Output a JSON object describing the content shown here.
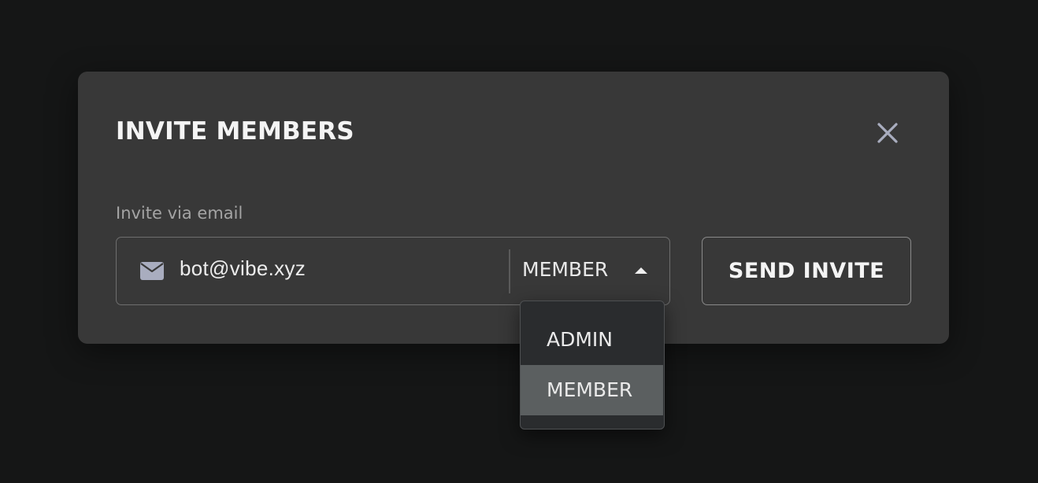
{
  "modal": {
    "title": "INVITE MEMBERS",
    "close_icon": "close-icon"
  },
  "invite": {
    "label": "Invite via email",
    "email_icon": "mail-icon",
    "email_value": "bot@vibe.xyz",
    "role_selected": "MEMBER",
    "role_caret_icon": "caret-up-icon",
    "send_label": "SEND INVITE"
  },
  "dropdown": {
    "options": [
      {
        "label": "ADMIN",
        "selected": false
      },
      {
        "label": "MEMBER",
        "selected": true
      }
    ]
  },
  "colors": {
    "page_background": "#151616",
    "modal_background": "#383838",
    "dropdown_background": "#2a2c2e",
    "selected_option": "#5b5f60",
    "icon": "#a9adbf"
  }
}
